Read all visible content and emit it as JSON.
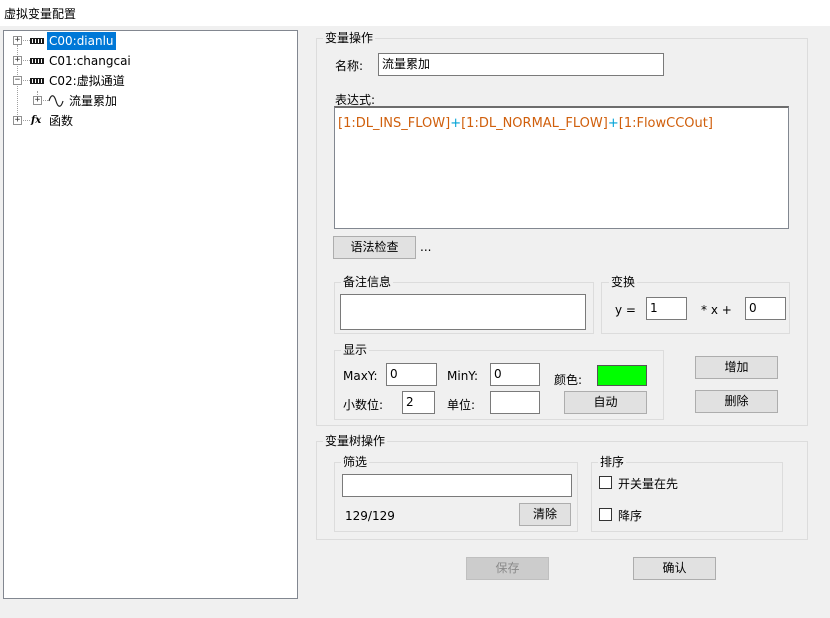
{
  "window": {
    "title": "虚拟变量配置"
  },
  "tree": {
    "nodes": [
      {
        "label": "C00:dianlu",
        "expander": "+",
        "icon": "channel-icon",
        "selected": true
      },
      {
        "label": "C01:changcai",
        "expander": "+",
        "icon": "channel-icon"
      },
      {
        "label": "C02:虚拟通道",
        "expander": "−",
        "icon": "channel-icon"
      },
      {
        "label": "流量累加",
        "expander": "+",
        "icon": "sine-wave-icon"
      },
      {
        "label": "函数",
        "expander": "+",
        "icon": "function-icon"
      }
    ],
    "function_icon_glyph": "fx"
  },
  "var_ops": {
    "title": "变量操作",
    "name_label": "名称:",
    "name_value": "流量累加",
    "expr_label": "表达式:",
    "expr_tokens": [
      {
        "text": "[1:DL_INS_FLOW]",
        "kind": "var"
      },
      {
        "text": "+",
        "kind": "op"
      },
      {
        "text": "[1:DL_NORMAL_FLOW]",
        "kind": "var"
      },
      {
        "text": "+",
        "kind": "op"
      },
      {
        "text": "[1:FlowCCOut]",
        "kind": "var"
      }
    ],
    "syntax_check_button": "语法检查",
    "ellipsis": "...",
    "remark": {
      "title": "备注信息",
      "value": ""
    },
    "transform": {
      "title": "变换",
      "y_label": "y =",
      "k_value": "1",
      "x_label": "* x +",
      "b_value": "0"
    },
    "display": {
      "title": "显示",
      "maxy_label": "MaxY:",
      "maxy_value": "0",
      "miny_label": "MinY:",
      "miny_value": "0",
      "color_label": "颜色:",
      "color": "#00ff00",
      "decimals_label": "小数位:",
      "decimals_value": "2",
      "unit_label": "单位:",
      "unit_value": "",
      "auto_button": "自动"
    },
    "add_button": "增加",
    "delete_button": "删除"
  },
  "tree_ops": {
    "title": "变量树操作",
    "filter": {
      "title": "筛选",
      "value": "",
      "count": "129/129",
      "clear_button": "清除"
    },
    "sort": {
      "title": "排序",
      "switch_first_label": "开关量在先",
      "switch_first_checked": false,
      "desc_label": "降序",
      "desc_checked": false
    }
  },
  "footer": {
    "save_button": "保存",
    "save_enabled": false,
    "confirm_button": "确认"
  },
  "colors": {
    "selection": "#0078d7",
    "expr_var": "#d05f0c",
    "expr_op": "#00a2d6"
  }
}
